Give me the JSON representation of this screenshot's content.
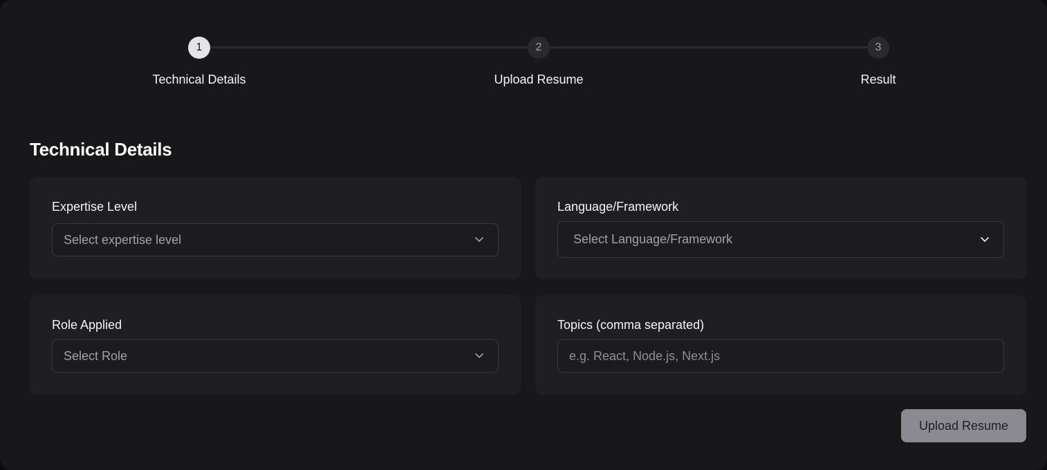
{
  "stepper": {
    "steps": [
      {
        "number": "1",
        "label": "Technical Details",
        "state": "active"
      },
      {
        "number": "2",
        "label": "Upload Resume",
        "state": "inactive"
      },
      {
        "number": "3",
        "label": "Result",
        "state": "inactive"
      }
    ]
  },
  "form": {
    "title": "Technical Details",
    "fields": {
      "expertise": {
        "label": "Expertise Level",
        "placeholder": "Select expertise level",
        "icon": "chevron-down-icon"
      },
      "language": {
        "label": "Language/Framework",
        "placeholder": "Select Language/Framework",
        "icon": "chevron-down-icon"
      },
      "role": {
        "label": "Role Applied",
        "placeholder": "Select Role",
        "icon": "chevron-down-icon"
      },
      "topics": {
        "label": "Topics (comma separated)",
        "placeholder": "e.g. React, Node.js, Next.js",
        "value": ""
      }
    },
    "submit_label": "Upload Resume"
  },
  "colors": {
    "background": "#18181b",
    "panel": "#1f1f23",
    "active_step": "#e4e4e7",
    "inactive_step": "#2a2a2e",
    "button_disabled": "#8a8a90"
  }
}
